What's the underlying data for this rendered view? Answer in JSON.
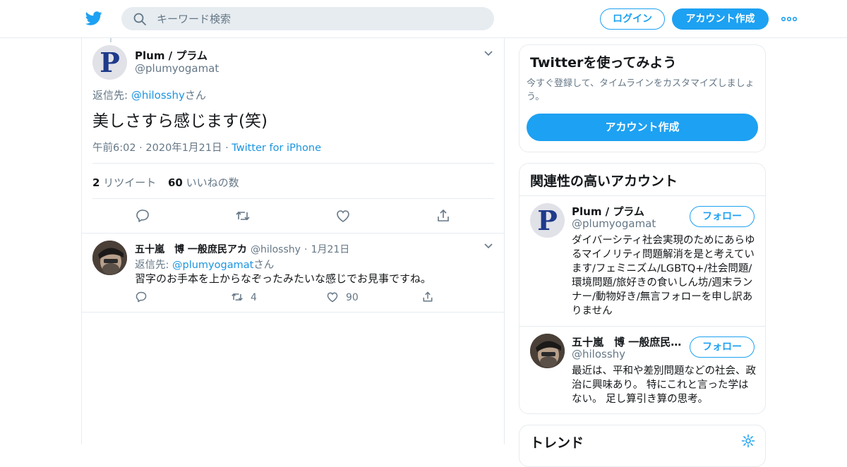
{
  "header": {
    "search_placeholder": "キーワード検索",
    "login_label": "ログイン",
    "signup_label": "アカウント作成"
  },
  "tweet": {
    "author_name": "Plum / プラム",
    "author_handle": "@plumyogamat",
    "avatar_letter": "P",
    "reply_prefix": "返信先:",
    "reply_to": "@hilosshy",
    "reply_suffix": "さん",
    "text": "美しさすら感じます(笑)",
    "time": "午前6:02 · 2020年1月21日",
    "source_sep": "·",
    "source": "Twitter for iPhone",
    "retweets_count": "2",
    "retweets_label": "リツイート",
    "likes_count": "60",
    "likes_label": "いいねの数"
  },
  "reply": {
    "author_name": "五十嵐　博 一般庶民アカ",
    "author_handle": "@hilosshy",
    "date_sep": "·",
    "date": "1月21日",
    "reply_prefix": "返信先:",
    "reply_to": "@plumyogamat",
    "reply_suffix": "さん",
    "text": "習字のお手本を上からなぞったみたいな感じでお見事ですね。",
    "retweets": "4",
    "likes": "90"
  },
  "signup_card": {
    "title": "Twitterを使ってみよう",
    "desc_line1": "今すぐ登録して、タイムラインをカスタマイズしましょ",
    "desc_line2": "う。",
    "button": "アカウント作成"
  },
  "related_card": {
    "title": "関連性の高いアカウント",
    "follow_label": "フォロー",
    "accounts": [
      {
        "name": "Plum / プラム",
        "handle": "@plumyogamat",
        "bio": "ダイバーシティ社会実現のためにあらゆるマイノリティ問題解消を是と考えています/フェミニズム/LGBTQ+/社会問題/環境問題/旅好きの食いしん坊/週末ランナー/動物好き/無言フォローを申し訳ありません"
      },
      {
        "name": "五十嵐　博 一般庶民…",
        "handle": "@hilosshy",
        "bio": "最近は、平和や差別問題などの社会、政治に興味あり。 特にこれと言った学はない。 足し算引き算の思考。"
      }
    ]
  },
  "trends_card": {
    "title": "トレンド"
  },
  "colors": {
    "accent": "#1da1f2",
    "link": "#1b95e0",
    "muted": "#657786",
    "border": "#e6ecf0"
  }
}
